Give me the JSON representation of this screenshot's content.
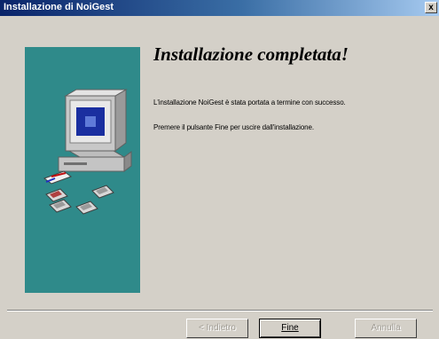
{
  "window": {
    "title": "Installazione di NoiGest",
    "close_label": "x"
  },
  "content": {
    "heading": "Installazione completata!",
    "message1": "L'installazione NoiGest è stata portata a termine con successo.",
    "message2": "Premere il pulsante Fine per uscire dall'installazione."
  },
  "buttons": {
    "back_label": "< Indietro",
    "finish_label": "Fine",
    "cancel_label": "Annulla"
  },
  "colors": {
    "side_panel": "#2f8a8a",
    "titlebar_start": "#0a246a",
    "dialog_bg": "#d4d0c8"
  },
  "icons": {
    "side_illustration": "computer-with-disks-illustration"
  }
}
